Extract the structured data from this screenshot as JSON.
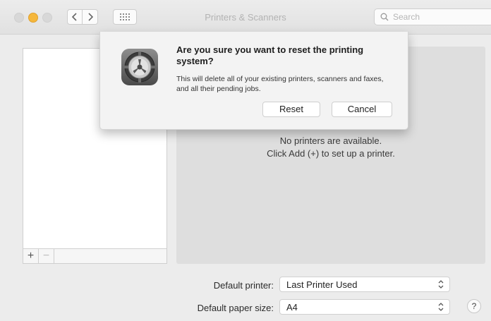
{
  "window": {
    "title": "Printers & Scanners"
  },
  "search": {
    "placeholder": "Search"
  },
  "list": {
    "add_label": "+",
    "remove_label": "−"
  },
  "main": {
    "empty_line1": "No printers are available.",
    "empty_line2": "Click Add (+) to set up a printer."
  },
  "settings": {
    "default_printer_label": "Default printer:",
    "default_printer_value": "Last Printer Used",
    "paper_size_label": "Default paper size:",
    "paper_size_value": "A4",
    "help_label": "?"
  },
  "dialog": {
    "title": "Are you sure you want to reset the printing system?",
    "body": "This will delete all of your existing printers, scanners and faxes, and all their pending jobs.",
    "reset_label": "Reset",
    "cancel_label": "Cancel",
    "icon": "system-preferences-gear-icon"
  },
  "colors": {
    "minimize": "#f5b73c",
    "panel": "#dedede"
  }
}
